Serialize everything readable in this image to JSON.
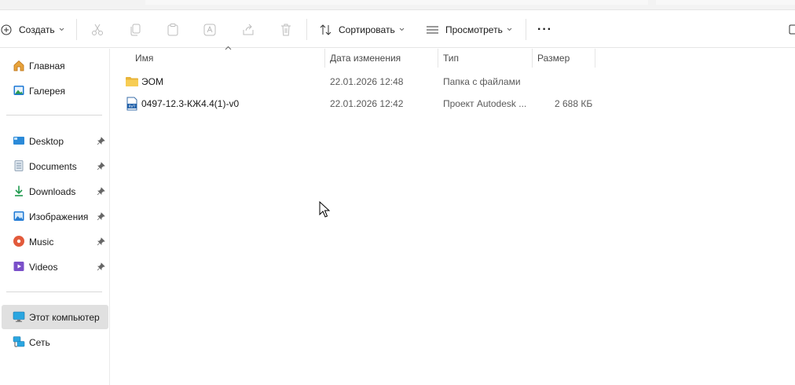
{
  "toolbar": {
    "create_label": "Создать",
    "sort_label": "Сортировать",
    "view_label": "Просмотреть",
    "more_label": "···"
  },
  "sidebar": {
    "items": [
      {
        "label": "Главная",
        "icon": "home-icon"
      },
      {
        "label": "Галерея",
        "icon": "gallery-icon"
      },
      {
        "label": "Desktop",
        "icon": "desktop-icon",
        "pinned": true
      },
      {
        "label": "Documents",
        "icon": "documents-icon",
        "pinned": true
      },
      {
        "label": "Downloads",
        "icon": "downloads-icon",
        "pinned": true
      },
      {
        "label": "Изображения",
        "icon": "pictures-icon",
        "pinned": true
      },
      {
        "label": "Music",
        "icon": "music-icon",
        "pinned": true
      },
      {
        "label": "Videos",
        "icon": "videos-icon",
        "pinned": true
      },
      {
        "label": "Этот компьютер",
        "icon": "this-pc-icon",
        "selected": true
      },
      {
        "label": "Сеть",
        "icon": "network-icon"
      }
    ]
  },
  "file_list": {
    "columns": [
      "Имя",
      "Дата изменения",
      "Тип",
      "Размер"
    ],
    "rows": [
      {
        "name": "ЭОМ",
        "date": "22.01.2026 12:48",
        "type": "Папка с файлами",
        "size": "",
        "icon": "folder-icon"
      },
      {
        "name": "0497-12.3-КЖ4.4(1)-v0",
        "date": "22.01.2026 12:42",
        "type": "Проект Autodesk ...",
        "size": "2 688 КБ",
        "icon": "rvt-file-icon"
      }
    ]
  },
  "colors": {
    "accent": "#0067c0",
    "selected_bg": "#e0e0e0",
    "folder": "#f4c542"
  }
}
